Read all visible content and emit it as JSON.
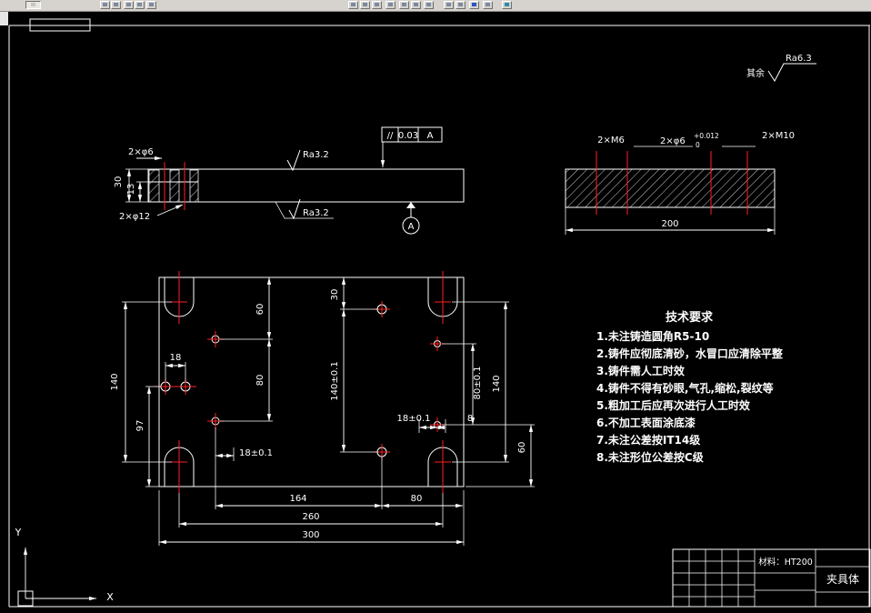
{
  "surface_note": {
    "rest": "其余",
    "ra": "Ra6.3"
  },
  "gdt": {
    "symbol": "//",
    "value": "0.03",
    "datum": "A"
  },
  "side_view": {
    "dia6": "2×φ6",
    "dia12": "2×φ12",
    "h30": "30",
    "h13": "13",
    "ra_top": "Ra3.2",
    "ra_bottom": "Ra3.2",
    "datum": "A"
  },
  "section_view": {
    "m6": "2×M6",
    "dia6": "2×φ6",
    "dia6_tol_up": "+0.012",
    "dia6_tol_low": "0",
    "m10": "2×M10",
    "w200": "200"
  },
  "plan": {
    "left140": "140",
    "left97": "97",
    "pair18": "18",
    "v60": "60",
    "v80": "80",
    "v30": "30",
    "v140t": "140±0.1",
    "h18t_bottom": "18±0.1",
    "h18t_right": "18±0.1",
    "h8": "8",
    "v80t": "80±0.1",
    "right140": "140",
    "right60": "60",
    "b164": "164",
    "b80": "80",
    "b260": "260",
    "b300": "300"
  },
  "tech": {
    "title": "技术要求",
    "items": [
      "1.未注铸造圆角R5-10",
      "2.铸件应彻底清砂，水冒口应清除平整",
      "3.铸件需人工时效",
      "4.铸件不得有砂眼,气孔,缩松,裂纹等",
      "5.粗加工后应再次进行人工时效",
      "6.不加工表面涂底漆",
      "7.未注公差按IT14级",
      "8.未注形位公差按C级"
    ]
  },
  "title_block": {
    "material": "材料：HT200",
    "part": "夹具体"
  },
  "ucs": {
    "x": "X",
    "y": "Y"
  },
  "colors": {
    "line": "#ffffff",
    "centerline": "#ff2020",
    "canvas": "#000000",
    "toolbar": "#d6d3ce"
  }
}
